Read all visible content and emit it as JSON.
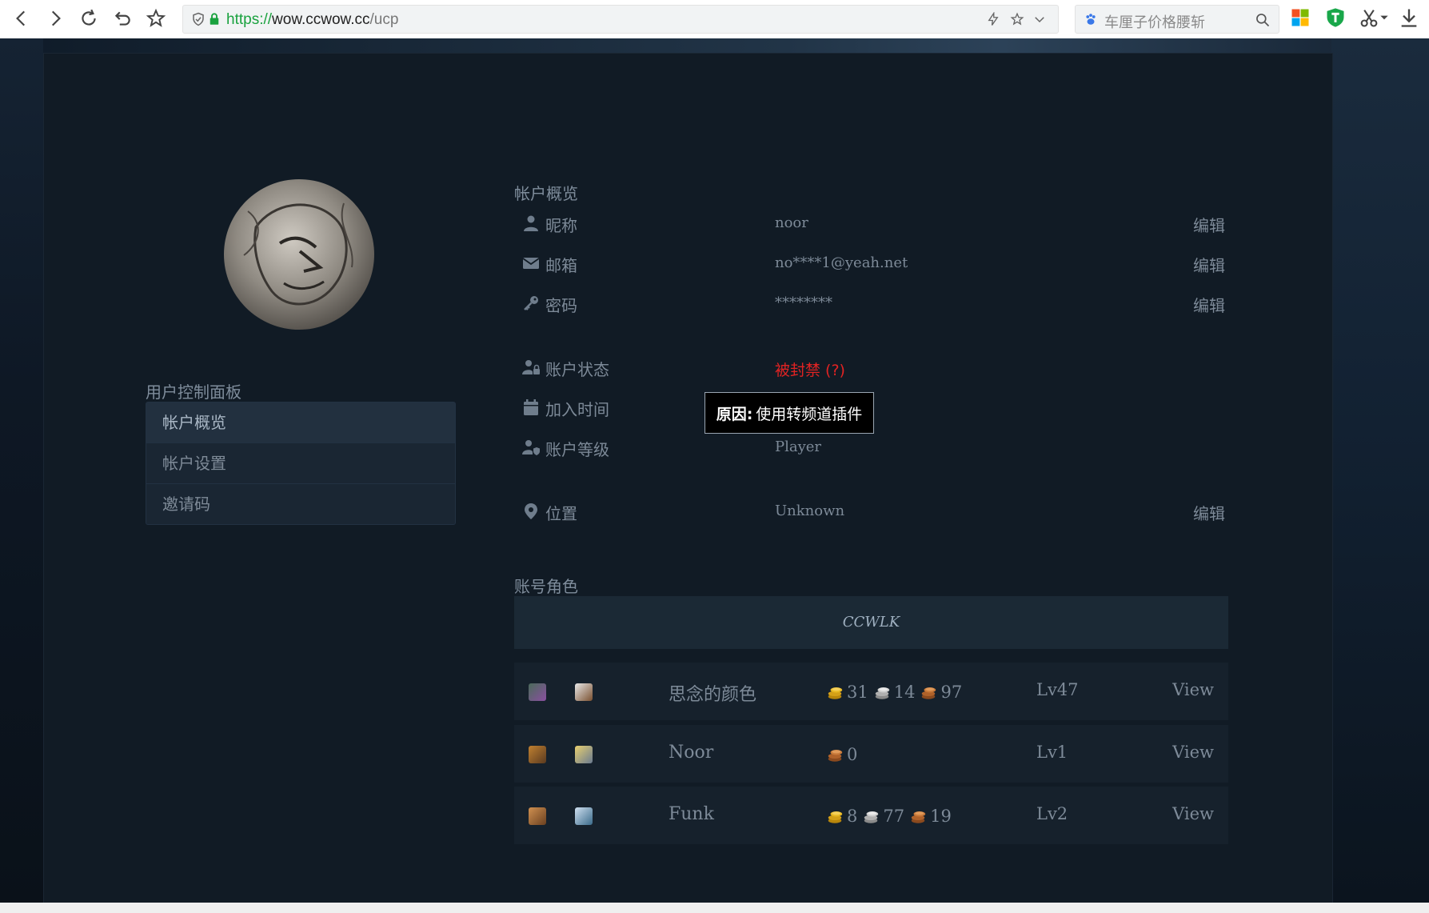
{
  "browser": {
    "url_protocol": "https://",
    "url_host": "wow.ccwow.cc",
    "url_path": "/ucp",
    "search_placeholder": "车厘子价格腰斩"
  },
  "sidebar": {
    "title": "用户控制面板",
    "items": [
      {
        "label": "帐户概览"
      },
      {
        "label": "帐户设置"
      },
      {
        "label": "邀请码"
      }
    ]
  },
  "overview": {
    "title": "帐户概览",
    "edit_label": "编辑",
    "nickname": {
      "label": "昵称",
      "value": "noor"
    },
    "email": {
      "label": "邮箱",
      "value": "no****1@yeah.net"
    },
    "password": {
      "label": "密码",
      "value": "********"
    },
    "status": {
      "label": "账户状态",
      "value": "被封禁 (?)"
    },
    "joined": {
      "label": "加入时间",
      "value": ""
    },
    "level": {
      "label": "账户等级",
      "value": "Player"
    },
    "location": {
      "label": "位置",
      "value": "Unknown"
    }
  },
  "tooltip": {
    "prefix": "原因:",
    "text": "使用转频道插件"
  },
  "characters": {
    "title": "账号角色",
    "realm": "CCWLK",
    "view_label": "View",
    "rows": [
      {
        "name": "思念的颜色",
        "gold": "31",
        "silver": "14",
        "copper": "97",
        "level": "Lv47"
      },
      {
        "name": "Noor",
        "copper": "0",
        "level": "Lv1"
      },
      {
        "name": "Funk",
        "gold": "8",
        "silver": "77",
        "copper": "19",
        "level": "Lv2"
      }
    ]
  },
  "colors": {
    "banned": "#e12323",
    "url_green": "#1aa23f",
    "panel_bg": "#111b25"
  }
}
